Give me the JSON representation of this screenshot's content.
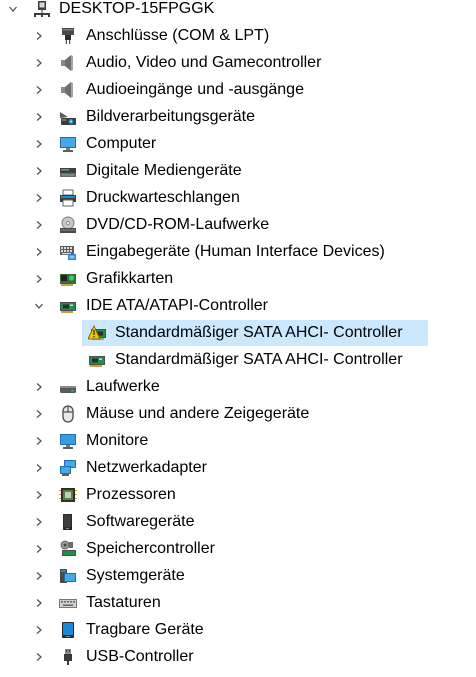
{
  "tree": {
    "root": {
      "label": "DESKTOP-15FPGGK",
      "expanded": true
    },
    "categories": [
      {
        "label": "Anschlüsse (COM & LPT)",
        "icon": "port-icon"
      },
      {
        "label": "Audio, Video und Gamecontroller",
        "icon": "speaker-icon"
      },
      {
        "label": "Audioeingänge und -ausgänge",
        "icon": "speaker-icon"
      },
      {
        "label": "Bildverarbeitungsgeräte",
        "icon": "camera-icon"
      },
      {
        "label": "Computer",
        "icon": "computer-icon"
      },
      {
        "label": "Digitale Mediengeräte",
        "icon": "media-device-icon"
      },
      {
        "label": "Druckwarteschlangen",
        "icon": "printer-icon"
      },
      {
        "label": "DVD/CD-ROM-Laufwerke",
        "icon": "optical-drive-icon"
      },
      {
        "label": "Eingabegeräte (Human Interface Devices)",
        "icon": "hid-icon"
      },
      {
        "label": "Grafikkarten",
        "icon": "graphics-card-icon"
      },
      {
        "label": "IDE ATA/ATAPI-Controller",
        "icon": "controller-card-icon",
        "expanded": true,
        "children": [
          {
            "label": "Standardmäßiger SATA AHCI- Controller",
            "icon": "warning-controller-icon",
            "selected": true
          },
          {
            "label": "Standardmäßiger SATA AHCI- Controller",
            "icon": "controller-card-icon"
          }
        ]
      },
      {
        "label": "Laufwerke",
        "icon": "disk-drive-icon"
      },
      {
        "label": "Mäuse und andere Zeigegeräte",
        "icon": "mouse-icon"
      },
      {
        "label": "Monitore",
        "icon": "monitor-icon"
      },
      {
        "label": "Netzwerkadapter",
        "icon": "network-icon"
      },
      {
        "label": "Prozessoren",
        "icon": "processor-icon"
      },
      {
        "label": "Softwaregeräte",
        "icon": "software-device-icon"
      },
      {
        "label": "Speichercontroller",
        "icon": "storage-controller-icon"
      },
      {
        "label": "Systemgeräte",
        "icon": "system-device-icon"
      },
      {
        "label": "Tastaturen",
        "icon": "keyboard-icon"
      },
      {
        "label": "Tragbare Geräte",
        "icon": "portable-device-icon"
      },
      {
        "label": "USB-Controller",
        "icon": "usb-icon"
      }
    ]
  },
  "colors": {
    "selection": "#cce8ff",
    "chevron": "#555555",
    "warning": "#f5c400"
  }
}
